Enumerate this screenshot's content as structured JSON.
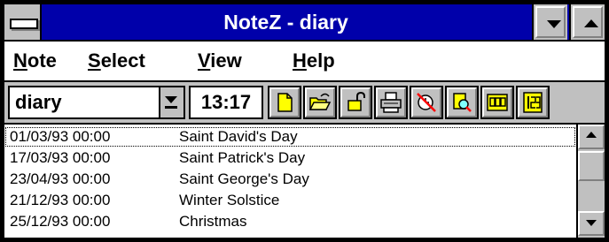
{
  "window": {
    "title": "NoteZ - diary"
  },
  "menubar": {
    "items": [
      {
        "mnemonic": "N",
        "rest": "ote"
      },
      {
        "mnemonic": "S",
        "rest": "elect"
      },
      {
        "mnemonic": "V",
        "rest": "iew"
      },
      {
        "mnemonic": "H",
        "rest": "elp"
      }
    ]
  },
  "toolbar": {
    "note_selector": {
      "value": "diary"
    },
    "clock": "13:17",
    "buttons": [
      "new-note-icon",
      "open-folder-icon",
      "unlock-icon",
      "printer-icon",
      "alarm-clock-icon",
      "search-note-icon",
      "abc-sort-icon",
      "123-sort-icon"
    ]
  },
  "entries": [
    {
      "datetime": "01/03/93 00:00",
      "title": "Saint David's Day",
      "selected": true
    },
    {
      "datetime": "17/03/93 00:00",
      "title": "Saint Patrick's Day",
      "selected": false
    },
    {
      "datetime": "23/04/93 00:00",
      "title": "Saint George's Day",
      "selected": false
    },
    {
      "datetime": "21/12/93 00:00",
      "title": "Winter Solstice",
      "selected": false
    },
    {
      "datetime": "25/12/93 00:00",
      "title": "Christmas",
      "selected": false
    }
  ],
  "colors": {
    "titlebar": "#0000aa",
    "face": "#c0c0c0",
    "list_bg": "#ffffff",
    "accent_yellow": "#ffff00"
  }
}
